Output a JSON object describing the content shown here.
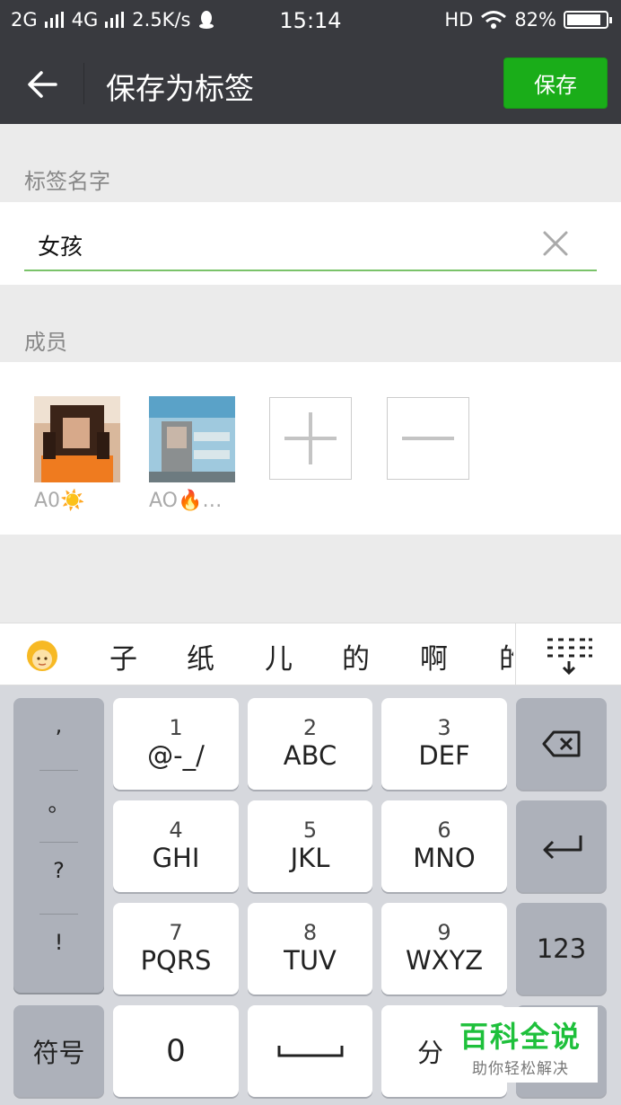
{
  "status": {
    "net1": "2G",
    "net2": "4G",
    "speed": "2.5K/s",
    "time": "15:14",
    "hd": "HD",
    "battery": "82%"
  },
  "header": {
    "title": "保存为标签",
    "save_label": "保存"
  },
  "name_section": {
    "label": "标签名字",
    "value": "女孩"
  },
  "members_section": {
    "label": "成员",
    "members": [
      {
        "name": "A0☀️"
      },
      {
        "name": "AO🔥…"
      }
    ]
  },
  "candidates": [
    "子",
    "纸",
    "儿",
    "的",
    "啊",
    "的"
  ],
  "keyboard": {
    "punct": [
      ",",
      "。",
      "?",
      "!"
    ],
    "keys": [
      {
        "num": "1",
        "letters": "@-_/"
      },
      {
        "num": "2",
        "letters": "ABC"
      },
      {
        "num": "3",
        "letters": "DEF"
      },
      {
        "num": "4",
        "letters": "GHI"
      },
      {
        "num": "5",
        "letters": "JKL"
      },
      {
        "num": "6",
        "letters": "MNO"
      },
      {
        "num": "7",
        "letters": "PQRS"
      },
      {
        "num": "8",
        "letters": "TUV"
      },
      {
        "num": "9",
        "letters": "WXYZ"
      }
    ],
    "num_toggle": "123",
    "symbols": "符号",
    "zero": "0",
    "fen": "分"
  },
  "watermark": {
    "main": "百科全说",
    "sub": "助你轻松解决"
  }
}
